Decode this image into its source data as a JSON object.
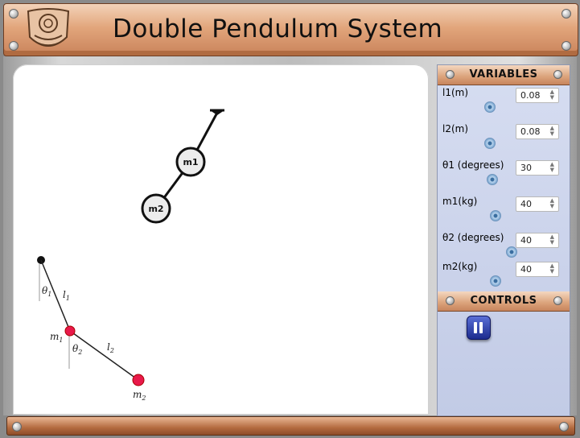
{
  "header": {
    "title": "Double Pendulum System",
    "logo_icon": "institute-emblem-icon"
  },
  "simulation": {
    "bob1_label": "m1",
    "bob2_label": "m2"
  },
  "diagram": {
    "theta1": "θ",
    "theta1_sub": "1",
    "theta2": "θ",
    "theta2_sub": "2",
    "l1": "l",
    "l1_sub": "1",
    "l2": "l",
    "l2_sub": "2",
    "m1": "m",
    "m1_sub": "1",
    "m2": "m",
    "m2_sub": "2"
  },
  "variables": {
    "heading": "VARIABLES",
    "items": [
      {
        "label": "l1(m)",
        "value": "0.08"
      },
      {
        "label": "l2(m)",
        "value": "0.08"
      },
      {
        "label": "θ1 (degrees)",
        "value": "30"
      },
      {
        "label": "m1(kg)",
        "value": "40"
      },
      {
        "label": "θ2 (degrees)",
        "value": "40"
      },
      {
        "label": "m2(kg)",
        "value": "40"
      }
    ]
  },
  "controls": {
    "heading": "CONTROLS",
    "pause_icon": "pause-icon"
  },
  "colors": {
    "accent_copper": "#d9976c",
    "panel_blue": "#c9d1ea",
    "bob_red": "#e8194b",
    "button_blue": "#1c2b8e"
  }
}
